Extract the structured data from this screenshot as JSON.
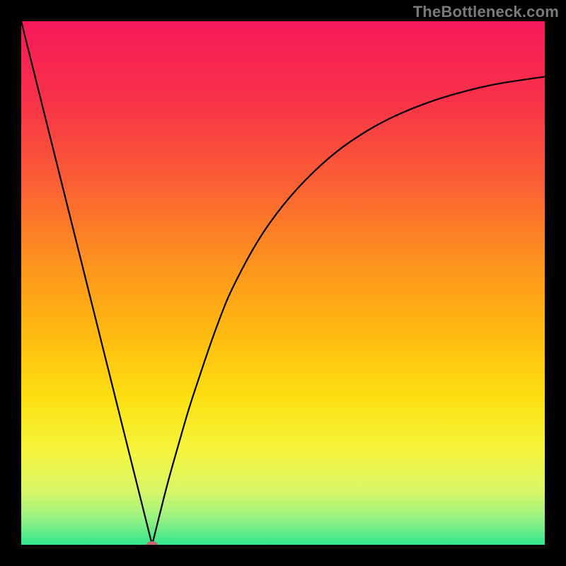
{
  "watermark": {
    "text": "TheBottleneck.com"
  },
  "colors": {
    "frame": "#000000",
    "curve_stroke": "#000000",
    "marker_fill": "#c9686d",
    "gradient_stops": [
      {
        "offset": 0.0,
        "color": "#f7195a"
      },
      {
        "offset": 0.15,
        "color": "#f83249"
      },
      {
        "offset": 0.3,
        "color": "#fa5d35"
      },
      {
        "offset": 0.45,
        "color": "#fd8f20"
      },
      {
        "offset": 0.6,
        "color": "#ffbb10"
      },
      {
        "offset": 0.72,
        "color": "#fce011"
      },
      {
        "offset": 0.82,
        "color": "#f6f53d"
      },
      {
        "offset": 0.9,
        "color": "#d7f66a"
      },
      {
        "offset": 0.95,
        "color": "#96f182"
      },
      {
        "offset": 1.0,
        "color": "#2fe78d"
      }
    ]
  },
  "chart_data": {
    "type": "line",
    "title": "",
    "xlabel": "",
    "ylabel": "",
    "xlim": [
      0,
      100
    ],
    "ylim": [
      0,
      100
    ],
    "grid": false,
    "series": [
      {
        "name": "bottleneck-curve",
        "x": [
          0,
          2,
          4,
          6,
          8,
          10,
          12,
          14,
          16,
          18,
          20,
          22,
          24,
          25,
          26,
          28,
          30,
          32,
          34,
          36,
          38,
          40,
          45,
          50,
          55,
          60,
          65,
          70,
          75,
          80,
          85,
          90,
          95,
          100
        ],
        "y": [
          100,
          92,
          84,
          76,
          68,
          60,
          52,
          44,
          36,
          28,
          20,
          12,
          4,
          0,
          4,
          12,
          19,
          26,
          32,
          38,
          43.5,
          48.5,
          58,
          65,
          70.5,
          75,
          78.5,
          81.3,
          83.5,
          85.3,
          86.7,
          87.9,
          88.7,
          89.4
        ]
      }
    ],
    "annotations": [
      {
        "name": "minimum-marker",
        "x": 25,
        "y": 0
      }
    ]
  }
}
